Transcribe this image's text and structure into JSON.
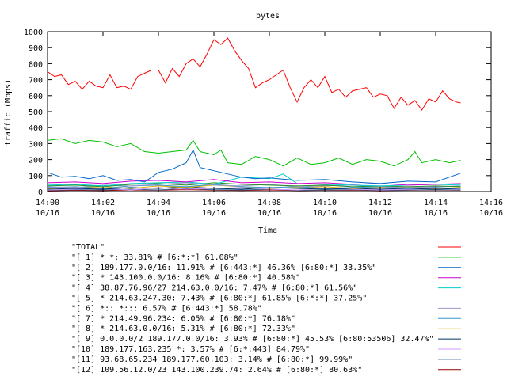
{
  "chart_data": {
    "type": "line",
    "title": "bytes",
    "xlabel": "Time",
    "ylabel": "traffic (Mbps)",
    "ylim": [
      0,
      1000
    ],
    "yticks": [
      "0",
      "100",
      "200",
      "300",
      "400",
      "500",
      "600",
      "700",
      "800",
      "900",
      "1000"
    ],
    "xlim_minutes": [
      0,
      16
    ],
    "xticks": [
      {
        "time": "14:00",
        "date": "10/16"
      },
      {
        "time": "14:02",
        "date": "10/16"
      },
      {
        "time": "14:04",
        "date": "10/16"
      },
      {
        "time": "14:06",
        "date": "10/16"
      },
      {
        "time": "14:08",
        "date": "10/16"
      },
      {
        "time": "14:10",
        "date": "10/16"
      },
      {
        "time": "14:12",
        "date": "10/16"
      },
      {
        "time": "14:14",
        "date": "10/16"
      },
      {
        "time": "14:16",
        "date": "10/16"
      }
    ],
    "grid": false,
    "legend_position": "bottom",
    "series": [
      {
        "name": "\"TOTAL\"",
        "color": "#ff0000",
        "x": [
          0.0,
          0.25,
          0.5,
          0.75,
          1.0,
          1.25,
          1.5,
          1.75,
          2.0,
          2.25,
          2.5,
          2.75,
          3.0,
          3.25,
          3.5,
          3.75,
          4.0,
          4.25,
          4.5,
          4.75,
          5.0,
          5.25,
          5.5,
          5.75,
          6.0,
          6.25,
          6.5,
          6.75,
          7.0,
          7.25,
          7.5,
          7.75,
          8.0,
          8.25,
          8.5,
          8.75,
          9.0,
          9.25,
          9.5,
          9.75,
          10.0,
          10.25,
          10.5,
          10.75,
          11.0,
          11.25,
          11.5,
          11.75,
          12.0,
          12.25,
          12.5,
          12.75,
          13.0,
          13.25,
          13.5,
          13.75,
          14.0,
          14.25,
          14.5,
          14.75,
          14.9
        ],
        "y": [
          750,
          720,
          730,
          670,
          690,
          640,
          690,
          660,
          650,
          730,
          650,
          660,
          640,
          720,
          740,
          760,
          760,
          680,
          770,
          720,
          800,
          830,
          780,
          860,
          950,
          920,
          960,
          880,
          820,
          770,
          650,
          680,
          700,
          730,
          760,
          650,
          560,
          650,
          700,
          650,
          720,
          620,
          640,
          590,
          630,
          640,
          650,
          590,
          610,
          600,
          520,
          590,
          540,
          570,
          510,
          580,
          560,
          630,
          580,
          560,
          555
        ]
      },
      {
        "name": "\"[ 1] * *: 33.81% # [6:*:*] 61.08%\"",
        "color": "#00c000",
        "x": [
          0.0,
          0.5,
          1.0,
          1.5,
          2.0,
          2.5,
          3.0,
          3.5,
          4.0,
          4.5,
          5.0,
          5.25,
          5.5,
          6.0,
          6.25,
          6.5,
          7.0,
          7.5,
          8.0,
          8.5,
          9.0,
          9.5,
          10.0,
          10.5,
          11.0,
          11.5,
          12.0,
          12.5,
          13.0,
          13.25,
          13.5,
          14.0,
          14.5,
          14.9
        ],
        "y": [
          320,
          330,
          300,
          320,
          310,
          280,
          300,
          250,
          240,
          250,
          260,
          320,
          250,
          230,
          260,
          180,
          170,
          220,
          200,
          160,
          210,
          170,
          180,
          210,
          170,
          200,
          190,
          160,
          200,
          250,
          180,
          200,
          180,
          195
        ]
      },
      {
        "name": "\"[ 2] 189.177.0.0/16: 11.91% # [6:443:*] 46.36% [6:80:*] 33.35%\"",
        "color": "#0066cc",
        "x": [
          0.0,
          0.5,
          1.0,
          1.5,
          2.0,
          2.5,
          3.0,
          3.5,
          4.0,
          4.5,
          5.0,
          5.25,
          5.5,
          6.0,
          6.5,
          7.0,
          7.5,
          8.0,
          9.0,
          10.0,
          11.0,
          12.0,
          13.0,
          14.0,
          14.9
        ],
        "y": [
          120,
          90,
          95,
          80,
          100,
          70,
          75,
          60,
          120,
          140,
          180,
          260,
          150,
          130,
          110,
          90,
          80,
          85,
          70,
          75,
          60,
          50,
          65,
          60,
          115
        ]
      },
      {
        "name": "\"[ 3] * 143.100.0.0/16: 8.16% # [6:80:*] 40.58%\"",
        "color": "#cc00cc",
        "x": [
          0.0,
          1.0,
          2.0,
          3.0,
          4.0,
          5.0,
          6.0,
          7.0,
          8.0,
          9.0,
          10.0,
          11.0,
          12.0,
          13.0,
          14.0,
          14.9
        ],
        "y": [
          55,
          60,
          50,
          65,
          70,
          60,
          75,
          55,
          60,
          50,
          55,
          45,
          50,
          40,
          45,
          50
        ]
      },
      {
        "name": "\"[ 4] 38.87.76.96/27 214.63.0.0/16: 7.47% # [6:80:*] 61.56%\"",
        "color": "#00cccc",
        "x": [
          0.0,
          1.0,
          2.0,
          3.0,
          4.0,
          5.0,
          6.0,
          7.0,
          8.0,
          8.5,
          9.0,
          10.0,
          11.0,
          12.0,
          13.0,
          14.0,
          14.9
        ],
        "y": [
          40,
          45,
          35,
          50,
          55,
          60,
          45,
          90,
          80,
          110,
          50,
          45,
          40,
          35,
          40,
          45,
          40
        ]
      },
      {
        "name": "\"[ 5] * 214.63.247.30: 7.43% # [6:80:*] 61.85% [6:*:*] 37.25%\"",
        "color": "#228b22",
        "x": [
          0.0,
          1.0,
          2.0,
          3.0,
          4.0,
          5.0,
          6.0,
          7.0,
          8.0,
          9.0,
          10.0,
          11.0,
          12.0,
          13.0,
          14.0,
          14.9
        ],
        "y": [
          35,
          40,
          30,
          45,
          50,
          40,
          55,
          45,
          40,
          35,
          40,
          30,
          35,
          30,
          35,
          30
        ]
      },
      {
        "name": "\"[ 6] *:: *::: 6.57% # [6:443:*] 58.78%\"",
        "color": "#9999cc",
        "x": [
          0.0,
          1.0,
          2.0,
          3.0,
          4.0,
          5.0,
          6.0,
          7.0,
          8.0,
          9.0,
          10.0,
          11.0,
          12.0,
          13.0,
          14.0,
          14.9
        ],
        "y": [
          30,
          25,
          40,
          35,
          45,
          55,
          40,
          35,
          45,
          30,
          35,
          40,
          30,
          25,
          30,
          35
        ]
      },
      {
        "name": "\"[ 7] * 214.49.96.234: 6.05% # [6:80:*] 76.18%\"",
        "color": "#3399cc",
        "x": [
          0.0,
          1.0,
          2.0,
          3.0,
          4.0,
          5.0,
          6.0,
          7.0,
          8.0,
          9.0,
          10.0,
          11.0,
          12.0,
          13.0,
          14.0,
          14.9
        ],
        "y": [
          25,
          30,
          20,
          35,
          40,
          30,
          45,
          30,
          25,
          30,
          20,
          25,
          30,
          20,
          25,
          20
        ]
      },
      {
        "name": "\"[ 8] * 214.63.0.0/16: 5.31% # [6:80:*] 72.33%\"",
        "color": "#e6b400",
        "x": [
          0.0,
          1.0,
          2.0,
          3.0,
          4.0,
          5.0,
          6.0,
          7.0,
          8.0,
          9.0,
          10.0,
          11.0,
          12.0,
          13.0,
          14.0,
          14.9
        ],
        "y": [
          20,
          25,
          30,
          20,
          35,
          25,
          40,
          30,
          20,
          25,
          30,
          20,
          25,
          30,
          20,
          25
        ]
      },
      {
        "name": "\"[ 9] 0.0.0.0/2 189.177.0.0/16: 3.93% # [6:80:*] 45.53% [6:80:53506] 32.47%\"",
        "color": "#003366",
        "x": [
          0.0,
          1.0,
          2.0,
          3.0,
          4.0,
          5.0,
          6.0,
          7.0,
          8.0,
          9.0,
          10.0,
          11.0,
          12.0,
          13.0,
          14.0,
          14.9
        ],
        "y": [
          15,
          20,
          15,
          25,
          20,
          30,
          20,
          15,
          25,
          20,
          15,
          20,
          15,
          20,
          15,
          20
        ]
      },
      {
        "name": "\"[10] 189.177.163.235 *: 3.57% # [6:*:443] 84.79%\"",
        "color": "#cc99ff",
        "x": [
          0.0,
          1.0,
          2.0,
          3.0,
          4.0,
          5.0,
          6.0,
          7.0,
          8.0,
          9.0,
          10.0,
          11.0,
          12.0,
          13.0,
          14.0,
          14.9
        ],
        "y": [
          10,
          15,
          20,
          10,
          25,
          15,
          20,
          25,
          15,
          10,
          20,
          15,
          10,
          15,
          20,
          15
        ]
      },
      {
        "name": "\"[11] 93.68.65.234 189.177.60.103: 3.14% # [6:80:*] 99.99%\"",
        "color": "#336699",
        "x": [
          0.0,
          1.0,
          2.0,
          3.0,
          4.0,
          5.0,
          6.0,
          7.0,
          8.0,
          9.0,
          10.0,
          11.0,
          12.0,
          13.0,
          14.0,
          14.9
        ],
        "y": [
          8,
          12,
          10,
          15,
          10,
          20,
          12,
          10,
          15,
          8,
          10,
          12,
          8,
          10,
          12,
          10
        ]
      },
      {
        "name": "\"[12] 109.56.12.0/23 143.100.239.74: 2.64% # [6:80:*] 80.63%\"",
        "color": "#990000",
        "x": [
          0.0,
          1.0,
          2.0,
          3.0,
          4.0,
          5.0,
          6.0,
          7.0,
          8.0,
          9.0,
          10.0,
          11.0,
          12.0,
          13.0,
          14.0,
          14.9
        ],
        "y": [
          5,
          8,
          6,
          10,
          8,
          12,
          9,
          7,
          10,
          6,
          8,
          9,
          6,
          8,
          10,
          8
        ]
      }
    ]
  }
}
